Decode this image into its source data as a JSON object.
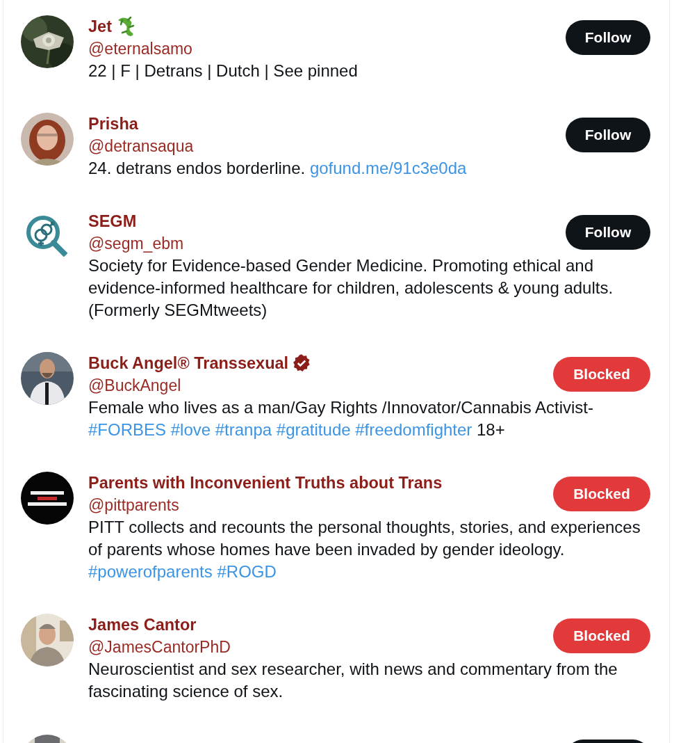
{
  "accounts": [
    {
      "name": "Jet",
      "badge": {
        "kind": "lizard"
      },
      "handle": "@eternalsamo",
      "avatar": {
        "kind": "picture"
      },
      "bio": [
        {
          "kind": "text",
          "text": "22 | F | Detrans | Dutch | See pinned"
        }
      ],
      "button": {
        "kind": "follow",
        "label": "Follow"
      }
    },
    {
      "name": "Prisha",
      "handle": "@detransaqua",
      "avatar": {
        "kind": "picture"
      },
      "bio": [
        {
          "kind": "text",
          "text": "24. detrans endos borderline. "
        },
        {
          "kind": "link",
          "text": "gofund.me/91c3e0da"
        }
      ],
      "button": {
        "kind": "follow",
        "label": "Follow"
      }
    },
    {
      "name": "SEGM",
      "handle": "@segm_ebm",
      "avatar": {
        "kind": "logo"
      },
      "bio": [
        {
          "kind": "text",
          "text": "Society for Evidence-based Gender Medicine. Promoting ethical and evidence-informed healthcare for children, adolescents & young adults. (Formerly SEGMtweets)"
        }
      ],
      "button": {
        "kind": "follow",
        "label": "Follow"
      }
    },
    {
      "name": "Buck Angel® Transsexual",
      "badge": {
        "kind": "verified"
      },
      "handle": "@BuckAngel",
      "avatar": {
        "kind": "picture"
      },
      "bio": [
        {
          "kind": "text",
          "text": "Female who lives as a man/Gay Rights /Innovator/Cannabis Activist-"
        },
        {
          "kind": "link",
          "text": "#FORBES"
        },
        {
          "kind": "link",
          "text": "#love"
        },
        {
          "kind": "link",
          "text": "#tranpa"
        },
        {
          "kind": "link",
          "text": "#gratitude"
        },
        {
          "kind": "link",
          "text": "#freedomfighter"
        },
        {
          "kind": "text",
          "text": " 18+"
        }
      ],
      "button": {
        "kind": "blocked",
        "label": "Blocked"
      }
    },
    {
      "name": "Parents with Inconvenient Truths about Trans",
      "handle": "@pittparents",
      "avatar": {
        "kind": "picture"
      },
      "bio": [
        {
          "kind": "text",
          "text": "PITT collects and recounts the personal thoughts, stories, and experiences of parents whose homes have been invaded by gender ideology. "
        },
        {
          "kind": "link",
          "text": "#powerofparents"
        },
        {
          "kind": "link",
          "text": "#ROGD"
        }
      ],
      "button": {
        "kind": "blocked",
        "label": "Blocked"
      }
    },
    {
      "name": "James Cantor",
      "handle": "@JamesCantorPhD",
      "avatar": {
        "kind": "picture"
      },
      "bio": [
        {
          "kind": "text",
          "text": "Neuroscientist and sex researcher, with news and commentary from the fascinating science of sex."
        }
      ],
      "button": {
        "kind": "blocked",
        "label": "Blocked"
      }
    }
  ],
  "cut_row": {
    "avatar": {
      "kind": "picture"
    },
    "button": {
      "kind": "follow"
    }
  }
}
